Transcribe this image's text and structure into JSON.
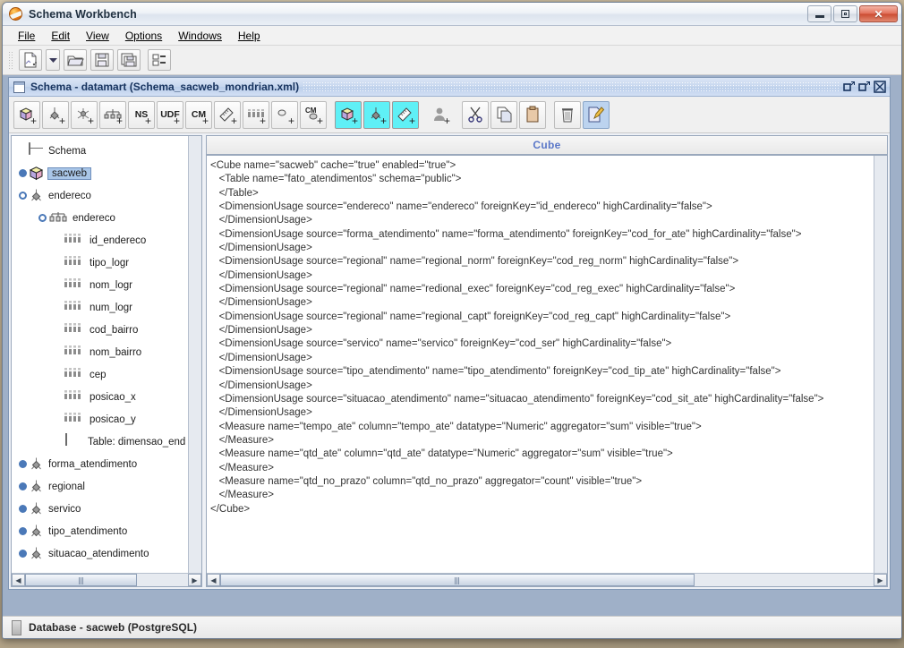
{
  "window": {
    "title": "Schema Workbench",
    "logo_icon": "pentaho-logo-icon",
    "minimize_label": "Minimize",
    "maximize_label": "Maximize",
    "close_label": "✕"
  },
  "menubar": {
    "items": [
      {
        "label": "File",
        "mnemonic": "F"
      },
      {
        "label": "Edit",
        "mnemonic": "E"
      },
      {
        "label": "View",
        "mnemonic": "V"
      },
      {
        "label": "Options",
        "mnemonic": "O"
      },
      {
        "label": "Windows",
        "mnemonic": "W"
      },
      {
        "label": "Help",
        "mnemonic": "H"
      }
    ]
  },
  "main_toolbar": {
    "buttons": [
      {
        "name": "new-schema-button",
        "icon": "new-document-icon",
        "tooltip": "New"
      },
      {
        "name": "new-schema-dropdown",
        "icon": "chevron-down-icon",
        "tooltip": "New menu"
      },
      {
        "name": "open-button",
        "icon": "open-folder-icon",
        "tooltip": "Open"
      },
      {
        "name": "save-button",
        "icon": "floppy-save-icon",
        "tooltip": "Save"
      },
      {
        "name": "save-as-button",
        "icon": "floppy-save-as-icon",
        "tooltip": "Save As"
      },
      {
        "name": "preferences-button",
        "icon": "list-properties-icon",
        "tooltip": "Preferences"
      }
    ]
  },
  "internal_frame": {
    "title": "Schema - datamart (Schema_sacweb_mondrian.xml)",
    "doc_icon": "window-document-icon",
    "buttons": [
      {
        "name": "iframe-minimize-button",
        "icon": "minimize-icon"
      },
      {
        "name": "iframe-maximize-button",
        "icon": "maximize-icon"
      },
      {
        "name": "iframe-close-button",
        "icon": "close-icon"
      }
    ]
  },
  "schema_toolbar": {
    "buttons": [
      {
        "name": "add-cube-button",
        "icon": "cube-add-icon",
        "label": "",
        "state": "boxed"
      },
      {
        "name": "add-dimension-button",
        "icon": "dimension-add-icon",
        "label": "",
        "state": "boxed"
      },
      {
        "name": "add-named-set-button",
        "icon": "hierarchy-star-add-icon",
        "label": "",
        "state": "boxed"
      },
      {
        "name": "add-hierarchy-button",
        "icon": "hierarchy-add-icon",
        "label": "",
        "state": "boxed"
      },
      {
        "name": "add-ns-button",
        "icon": "ns-add-icon",
        "label": "NS",
        "state": "boxed"
      },
      {
        "name": "add-udf-button",
        "icon": "udf-add-icon",
        "label": "UDF",
        "state": "boxed"
      },
      {
        "name": "add-calculated-member-button",
        "icon": "cm-add-icon",
        "label": "CM",
        "state": "boxed"
      },
      {
        "name": "add-measure-button",
        "icon": "measure-add-icon",
        "label": "",
        "state": "boxed"
      },
      {
        "name": "add-level-button",
        "icon": "level-add-icon",
        "label": "",
        "state": "boxed"
      },
      {
        "name": "add-property-button",
        "icon": "property-add-icon",
        "label": "",
        "state": "boxed"
      },
      {
        "name": "add-calculated-member-property-button",
        "icon": "cm-property-add-icon",
        "label": "CM",
        "state": "boxed"
      },
      {
        "name": "add-virtual-cube-button",
        "icon": "virtual-cube-add-icon",
        "label": "",
        "state": "highlighted"
      },
      {
        "name": "add-virtual-cube-dimension-button",
        "icon": "virtual-cube-dimension-add-icon",
        "label": "",
        "state": "highlighted"
      },
      {
        "name": "add-virtual-cube-measure-button",
        "icon": "virtual-cube-measure-add-icon",
        "label": "",
        "state": "highlighted"
      },
      {
        "name": "add-role-button",
        "icon": "user-role-add-icon",
        "label": "",
        "state": "plain"
      },
      {
        "name": "cut-button",
        "icon": "scissors-cut-icon",
        "label": "",
        "state": "boxed"
      },
      {
        "name": "copy-button",
        "icon": "copy-pages-icon",
        "label": "",
        "state": "boxed"
      },
      {
        "name": "paste-button",
        "icon": "clipboard-paste-icon",
        "label": "",
        "state": "boxed"
      },
      {
        "name": "delete-button",
        "icon": "trash-delete-icon",
        "label": "",
        "state": "boxed"
      },
      {
        "name": "edit-mode-button",
        "icon": "document-pencil-edit-icon",
        "label": "",
        "state": "selected"
      }
    ]
  },
  "tree": {
    "nodes": [
      {
        "label": "Schema",
        "icon": "database-schema-icon",
        "depth": 0,
        "handle": "none",
        "selected": false
      },
      {
        "label": "sacweb",
        "icon": "cube-icon",
        "depth": 1,
        "handle": "expandable",
        "selected": true
      },
      {
        "label": "endereco",
        "icon": "dimension-icon",
        "depth": 1,
        "handle": "expanded",
        "selected": false
      },
      {
        "label": "endereco",
        "icon": "hierarchy-icon",
        "depth": 2,
        "handle": "expanded",
        "selected": false
      },
      {
        "label": "id_endereco",
        "icon": "level-icon",
        "depth": 3,
        "handle": "none",
        "selected": false
      },
      {
        "label": "tipo_logr",
        "icon": "level-icon",
        "depth": 3,
        "handle": "none",
        "selected": false
      },
      {
        "label": "nom_logr",
        "icon": "level-icon",
        "depth": 3,
        "handle": "none",
        "selected": false
      },
      {
        "label": "num_logr",
        "icon": "level-icon",
        "depth": 3,
        "handle": "none",
        "selected": false
      },
      {
        "label": "cod_bairro",
        "icon": "level-icon",
        "depth": 3,
        "handle": "none",
        "selected": false
      },
      {
        "label": "nom_bairro",
        "icon": "level-icon",
        "depth": 3,
        "handle": "none",
        "selected": false
      },
      {
        "label": "cep",
        "icon": "level-icon",
        "depth": 3,
        "handle": "none",
        "selected": false
      },
      {
        "label": "posicao_x",
        "icon": "level-icon",
        "depth": 3,
        "handle": "none",
        "selected": false
      },
      {
        "label": "posicao_y",
        "icon": "level-icon",
        "depth": 3,
        "handle": "none",
        "selected": false
      },
      {
        "label": "Table: dimensao_end",
        "icon": "table-icon",
        "depth": 3,
        "handle": "none",
        "selected": false
      },
      {
        "label": "forma_atendimento",
        "icon": "dimension-icon",
        "depth": 1,
        "handle": "expandable",
        "selected": false
      },
      {
        "label": "regional",
        "icon": "dimension-icon",
        "depth": 1,
        "handle": "expandable",
        "selected": false
      },
      {
        "label": "servico",
        "icon": "dimension-icon",
        "depth": 1,
        "handle": "expandable",
        "selected": false
      },
      {
        "label": "tipo_atendimento",
        "icon": "dimension-icon",
        "depth": 1,
        "handle": "expandable",
        "selected": false
      },
      {
        "label": "situacao_atendimento",
        "icon": "dimension-icon",
        "depth": 1,
        "handle": "expandable",
        "selected": false
      }
    ]
  },
  "content": {
    "header": "Cube",
    "xml_lines": [
      "<Cube name=\"sacweb\" cache=\"true\" enabled=\"true\">",
      "   <Table name=\"fato_atendimentos\" schema=\"public\">",
      "   </Table>",
      "   <DimensionUsage source=\"endereco\" name=\"endereco\" foreignKey=\"id_endereco\" highCardinality=\"false\">",
      "   </DimensionUsage>",
      "   <DimensionUsage source=\"forma_atendimento\" name=\"forma_atendimento\" foreignKey=\"cod_for_ate\" highCardinality=\"false\">",
      "   </DimensionUsage>",
      "   <DimensionUsage source=\"regional\" name=\"regional_norm\" foreignKey=\"cod_reg_norm\" highCardinality=\"false\">",
      "   </DimensionUsage>",
      "   <DimensionUsage source=\"regional\" name=\"redional_exec\" foreignKey=\"cod_reg_exec\" highCardinality=\"false\">",
      "   </DimensionUsage>",
      "   <DimensionUsage source=\"regional\" name=\"regional_capt\" foreignKey=\"cod_reg_capt\" highCardinality=\"false\">",
      "   </DimensionUsage>",
      "   <DimensionUsage source=\"servico\" name=\"servico\" foreignKey=\"cod_ser\" highCardinality=\"false\">",
      "   </DimensionUsage>",
      "   <DimensionUsage source=\"tipo_atendimento\" name=\"tipo_atendimento\" foreignKey=\"cod_tip_ate\" highCardinality=\"false\">",
      "   </DimensionUsage>",
      "   <DimensionUsage source=\"situacao_atendimento\" name=\"situacao_atendimento\" foreignKey=\"cod_sit_ate\" highCardinality=\"false\">",
      "   </DimensionUsage>",
      "   <Measure name=\"tempo_ate\" column=\"tempo_ate\" datatype=\"Numeric\" aggregator=\"sum\" visible=\"true\">",
      "   </Measure>",
      "   <Measure name=\"qtd_ate\" column=\"qtd_ate\" datatype=\"Numeric\" aggregator=\"sum\" visible=\"true\">",
      "   </Measure>",
      "   <Measure name=\"qtd_no_prazo\" column=\"qtd_no_prazo\" aggregator=\"count\" visible=\"true\">",
      "   </Measure>",
      "</Cube>"
    ]
  },
  "scrollbars": {
    "tree_h_left_arrow": "◀",
    "tree_h_right_arrow": "▶",
    "content_h_left_arrow": "◀",
    "content_h_right_arrow": "▶"
  },
  "statusbar": {
    "icon": "database-icon",
    "text": "Database - sacweb (PostgreSQL)"
  },
  "colors": {
    "accent_blue": "#5a77c8",
    "selection_blue": "#a9c6e8",
    "toolbar_highlight": "#5ff0f6",
    "title_text": "#17335e"
  }
}
